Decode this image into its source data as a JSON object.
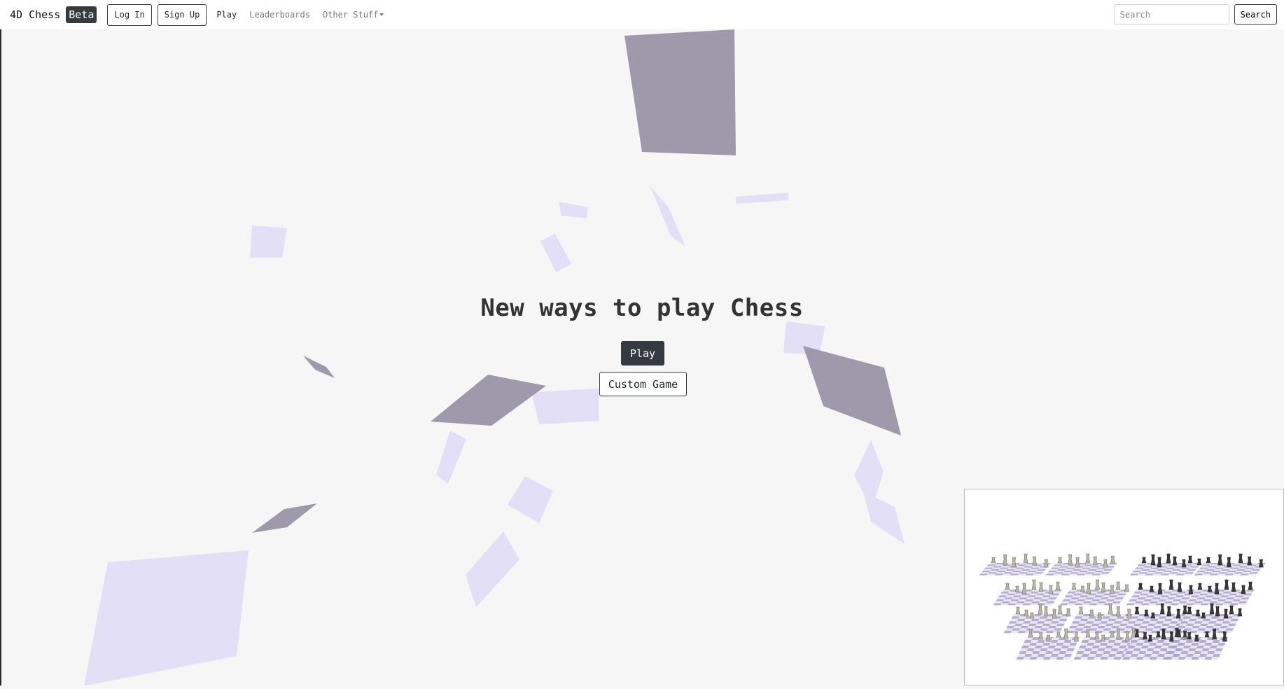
{
  "navbar": {
    "brand": "4D Chess",
    "badge": "Beta",
    "login_label": "Log In",
    "signup_label": "Sign Up",
    "links": [
      {
        "label": "Play"
      },
      {
        "label": "Leaderboards"
      },
      {
        "label": "Other Stuff"
      }
    ],
    "search_placeholder": "Search",
    "search_button": "Search"
  },
  "hero": {
    "title": "New ways to play Chess",
    "play_button": "Play",
    "custom_button": "Custom Game"
  },
  "colors": {
    "primary_dark": "#343a40",
    "shape_dark": "#9f9aab",
    "shape_light": "#e2dff7",
    "board_dark": "#a8a0c7",
    "board_light": "#e6e3f6",
    "background": "#f6f6f6"
  }
}
